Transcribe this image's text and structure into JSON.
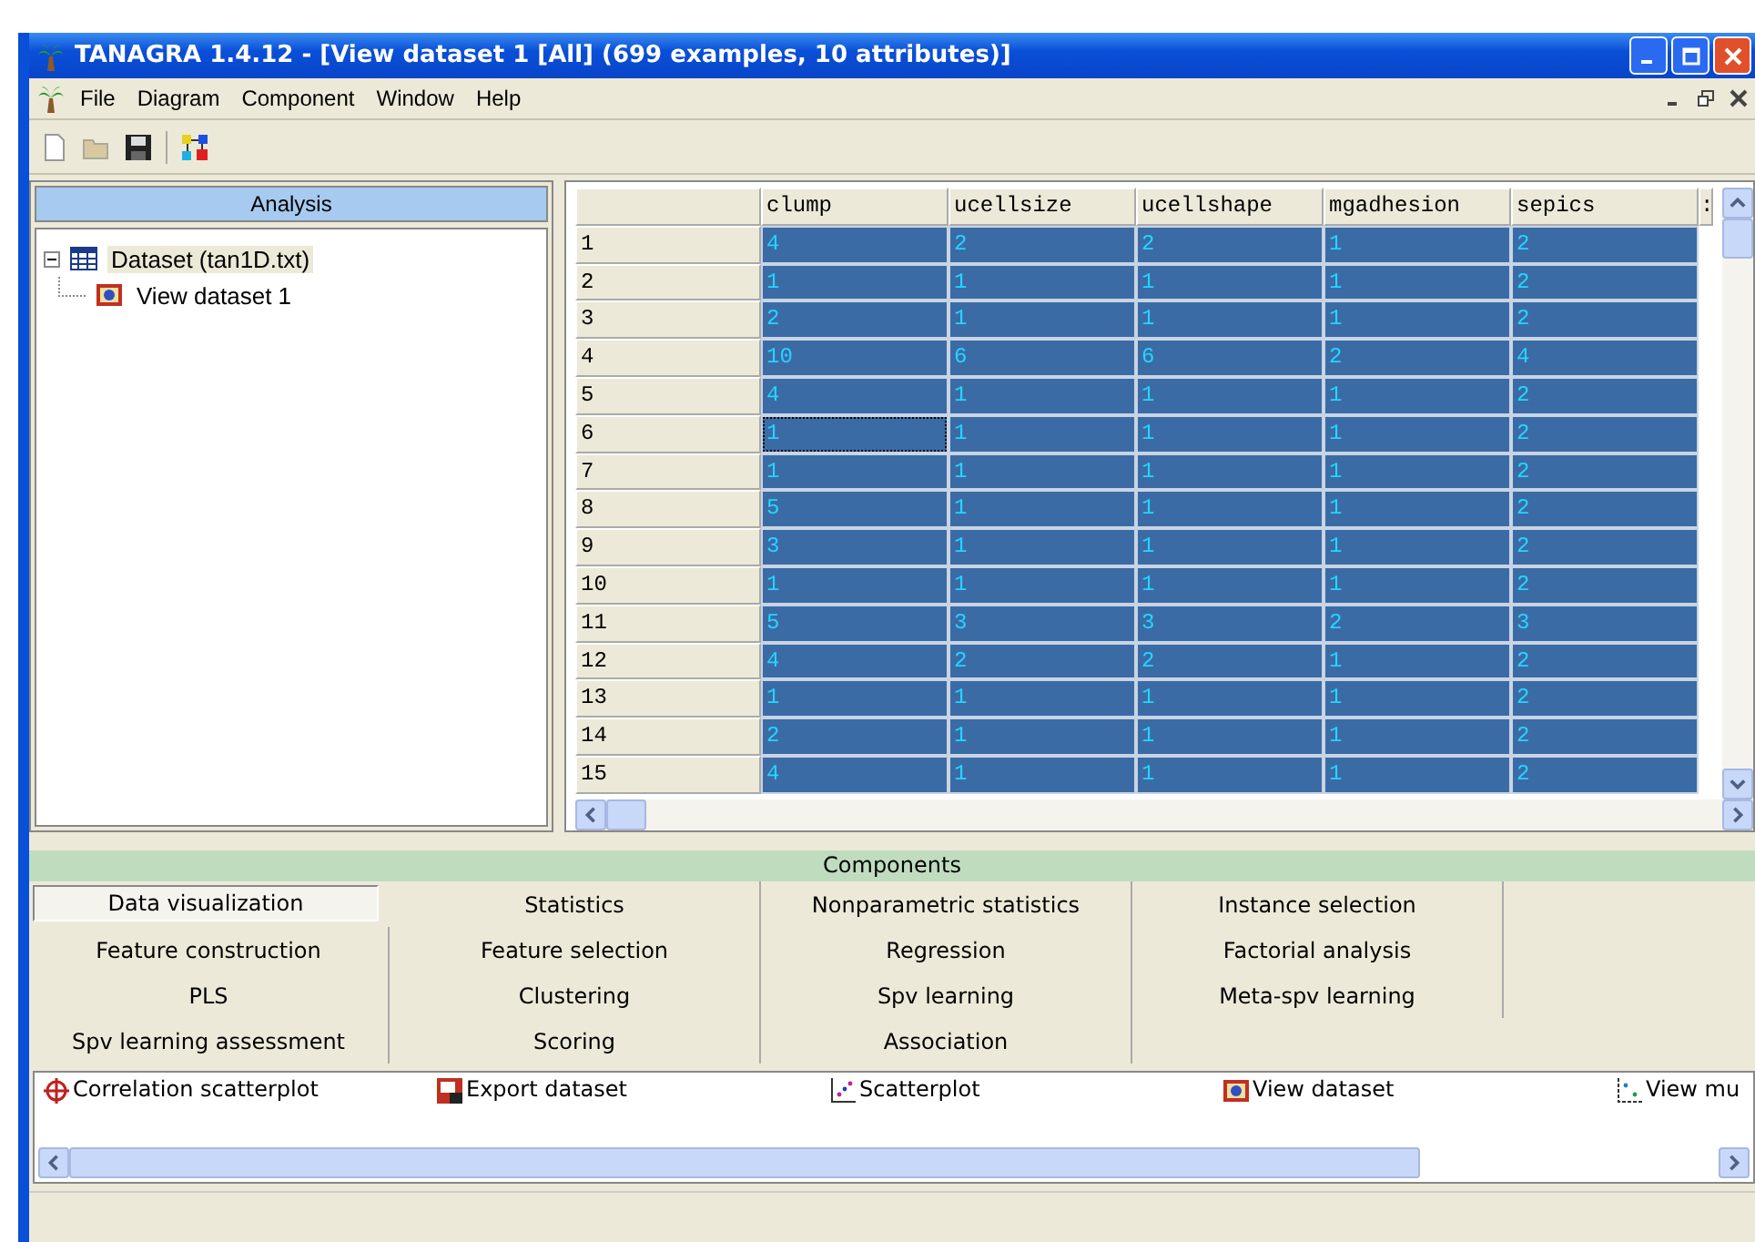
{
  "window": {
    "title": "TANAGRA 1.4.12 - [View dataset 1 [All] (699 examples, 10 attributes)]"
  },
  "menu": [
    "File",
    "Diagram",
    "Component",
    "Window",
    "Help"
  ],
  "analysis": {
    "title": "Analysis",
    "tree": [
      {
        "label": "Dataset (tan1D.txt)",
        "kind": "dataset",
        "expanded": true,
        "children": [
          {
            "label": "View dataset 1",
            "kind": "view"
          }
        ]
      }
    ]
  },
  "table": {
    "columns": [
      "clump",
      "ucellsize",
      "ucellshape",
      "mgadhesion",
      "sepics",
      ":"
    ],
    "rows": [
      {
        "label": "1",
        "cells": [
          "4",
          "2",
          "2",
          "1",
          "2"
        ],
        "selected": true,
        "focused": false
      },
      {
        "label": "2",
        "cells": [
          "1",
          "1",
          "1",
          "1",
          "2"
        ],
        "selected": true,
        "focused": false
      },
      {
        "label": "3",
        "cells": [
          "2",
          "1",
          "1",
          "1",
          "2"
        ],
        "selected": true,
        "focused": false
      },
      {
        "label": "4",
        "cells": [
          "10",
          "6",
          "6",
          "2",
          "4"
        ],
        "selected": true,
        "focused": false
      },
      {
        "label": "5",
        "cells": [
          "4",
          "1",
          "1",
          "1",
          "2"
        ],
        "selected": true,
        "focused": false
      },
      {
        "label": "6",
        "cells": [
          "1",
          "1",
          "1",
          "1",
          "2"
        ],
        "selected": true,
        "focused": true
      },
      {
        "label": "7",
        "cells": [
          "1",
          "1",
          "1",
          "1",
          "2"
        ],
        "selected": true,
        "focused": false
      },
      {
        "label": "8",
        "cells": [
          "5",
          "1",
          "1",
          "1",
          "2"
        ],
        "selected": true,
        "focused": false
      },
      {
        "label": "9",
        "cells": [
          "3",
          "1",
          "1",
          "1",
          "2"
        ],
        "selected": true,
        "focused": false
      },
      {
        "label": "10",
        "cells": [
          "1",
          "1",
          "1",
          "1",
          "2"
        ],
        "selected": true,
        "focused": false
      },
      {
        "label": "11",
        "cells": [
          "5",
          "3",
          "3",
          "2",
          "3"
        ],
        "selected": true,
        "focused": false
      },
      {
        "label": "12",
        "cells": [
          "4",
          "2",
          "2",
          "1",
          "2"
        ],
        "selected": true,
        "focused": false
      },
      {
        "label": "13",
        "cells": [
          "1",
          "1",
          "1",
          "1",
          "2"
        ],
        "selected": true,
        "focused": false
      },
      {
        "label": "14",
        "cells": [
          "2",
          "1",
          "1",
          "1",
          "2"
        ],
        "selected": true,
        "focused": false
      },
      {
        "label": "15",
        "cells": [
          "4",
          "1",
          "1",
          "1",
          "2"
        ],
        "selected": true,
        "focused": false
      }
    ]
  },
  "components": {
    "title": "Components",
    "tabs": [
      {
        "label": "Data visualization",
        "selected": true
      },
      {
        "label": "Statistics",
        "selected": false
      },
      {
        "label": "Nonparametric statistics",
        "selected": false
      },
      {
        "label": "Instance selection",
        "selected": false
      },
      {
        "label": "Feature construction",
        "selected": false
      },
      {
        "label": "Feature selection",
        "selected": false
      },
      {
        "label": "Regression",
        "selected": false
      },
      {
        "label": "Factorial analysis",
        "selected": false
      },
      {
        "label": "PLS",
        "selected": false
      },
      {
        "label": "Clustering",
        "selected": false
      },
      {
        "label": "Spv learning",
        "selected": false
      },
      {
        "label": "Meta-spv learning",
        "selected": false
      },
      {
        "label": "Spv learning assessment",
        "selected": false
      },
      {
        "label": "Scoring",
        "selected": false
      },
      {
        "label": "Association",
        "selected": false
      }
    ],
    "items": [
      {
        "label": "Correlation scatterplot",
        "kind": "crosshair"
      },
      {
        "label": "Export dataset",
        "kind": "export"
      },
      {
        "label": "Scatterplot",
        "kind": "scatter"
      },
      {
        "label": "View dataset",
        "kind": "view"
      },
      {
        "label": "View mu",
        "kind": "multi"
      }
    ]
  }
}
